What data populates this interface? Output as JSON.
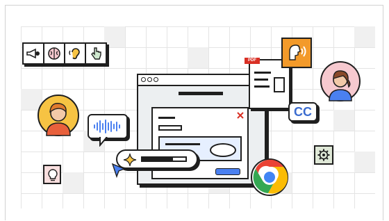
{
  "badges": {
    "cc_label": "CC",
    "pdf_label": "PDF"
  },
  "icons": {
    "strip": [
      "megaphone-icon",
      "brain-icon",
      "ear-icon",
      "hand-pointer-icon"
    ],
    "settings": "gear-icon",
    "hint": "lightbulb-icon",
    "sparkle": "sparkle-icon",
    "cursor": "cursor-icon",
    "close": "close-icon"
  },
  "colors": {
    "accent_blue": "#4a80f0",
    "orange": "#f39a2a",
    "pdf_red": "#d93025",
    "avatar_yellow": "#f6c343",
    "avatar_pink": "#f6c9cf",
    "outline": "#1f1f1f"
  }
}
